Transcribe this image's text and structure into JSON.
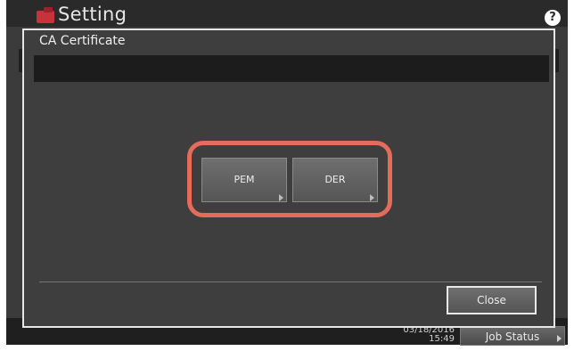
{
  "app": {
    "title": "Setting",
    "icon": "setting-icon",
    "help_icon": "help-icon",
    "help_glyph": "?"
  },
  "dialog": {
    "title": "CA Certificate",
    "buttons": [
      {
        "label": "PEM",
        "icon": "arrow-right-icon"
      },
      {
        "label": "DER",
        "icon": "arrow-right-icon"
      }
    ],
    "close_label": "Close"
  },
  "status_bar": {
    "date": "03/18/2016",
    "time": "15:49",
    "job_status_label": "Job Status"
  },
  "colors": {
    "highlight": "#e56b5a",
    "background": "#3b3b3b",
    "dialog_border": "#e6e6e6"
  }
}
